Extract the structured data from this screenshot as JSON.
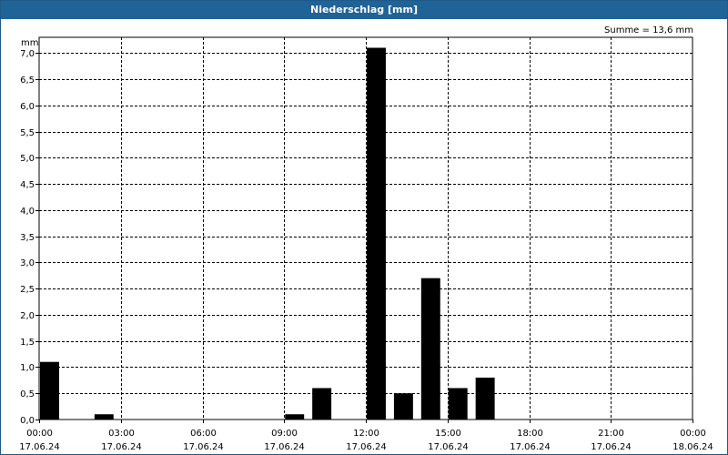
{
  "window": {
    "title": "Niederschlag [mm]"
  },
  "colors": {
    "titlebar": "#1f6397",
    "bars": "#000000",
    "grid": "#000000"
  },
  "chart_data": {
    "type": "bar",
    "title": "Niederschlag [mm]",
    "ylabel": "mm",
    "summary": "Summe = 13,6 mm",
    "ylim": [
      0,
      7.3
    ],
    "grid": "dashed",
    "yticks": [
      {
        "value": 0.0,
        "label": "0,0"
      },
      {
        "value": 0.5,
        "label": "0,5"
      },
      {
        "value": 1.0,
        "label": "1,0"
      },
      {
        "value": 1.5,
        "label": "1,5"
      },
      {
        "value": 2.0,
        "label": "2,0"
      },
      {
        "value": 2.5,
        "label": "2,5"
      },
      {
        "value": 3.0,
        "label": "3,0"
      },
      {
        "value": 3.5,
        "label": "3,5"
      },
      {
        "value": 4.0,
        "label": "4,0"
      },
      {
        "value": 4.5,
        "label": "4,5"
      },
      {
        "value": 5.0,
        "label": "5,0"
      },
      {
        "value": 5.5,
        "label": "5,5"
      },
      {
        "value": 6.0,
        "label": "6,0"
      },
      {
        "value": 6.5,
        "label": "6,5"
      },
      {
        "value": 7.0,
        "label": "7,0"
      }
    ],
    "xticks": [
      {
        "time": "00:00",
        "date": "17.06.24"
      },
      {
        "time": "03:00",
        "date": "17.06.24"
      },
      {
        "time": "06:00",
        "date": "17.06.24"
      },
      {
        "time": "09:00",
        "date": "17.06.24"
      },
      {
        "time": "12:00",
        "date": "17.06.24"
      },
      {
        "time": "15:00",
        "date": "17.06.24"
      },
      {
        "time": "18:00",
        "date": "17.06.24"
      },
      {
        "time": "21:00",
        "date": "17.06.24"
      },
      {
        "time": "00:00",
        "date": "18.06.24"
      }
    ],
    "categories": [
      "00:00",
      "01:00",
      "02:00",
      "03:00",
      "04:00",
      "05:00",
      "06:00",
      "07:00",
      "08:00",
      "09:00",
      "10:00",
      "11:00",
      "12:00",
      "13:00",
      "14:00",
      "15:00",
      "16:00",
      "17:00",
      "18:00",
      "19:00",
      "20:00",
      "21:00",
      "22:00",
      "23:00"
    ],
    "values": [
      1.1,
      0.0,
      0.1,
      0.0,
      0.0,
      0.0,
      0.0,
      0.0,
      0.0,
      0.1,
      0.6,
      0.0,
      7.1,
      0.5,
      2.7,
      0.6,
      0.8,
      0.0,
      0.0,
      0.0,
      0.0,
      0.0,
      0.0,
      0.0
    ]
  }
}
